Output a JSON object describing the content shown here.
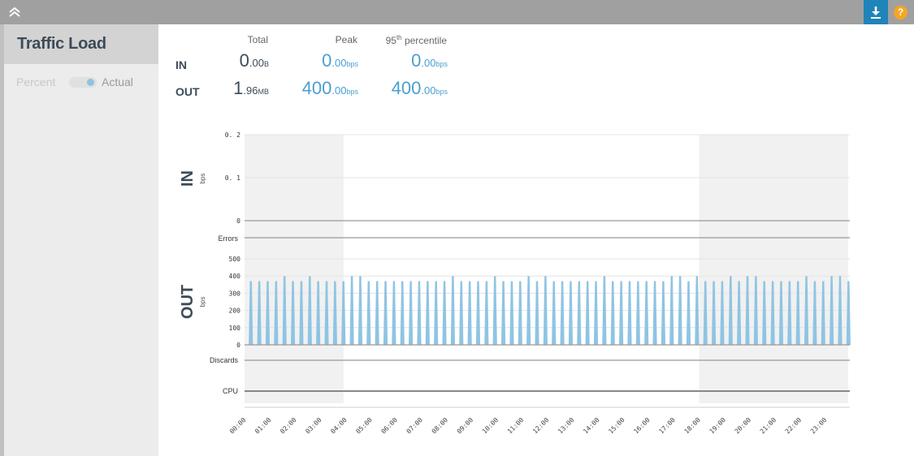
{
  "topbar": {
    "collapse_icon": "double-chevron-up-icon",
    "download_icon": "download-icon",
    "help_label": "?",
    "download_color": "#1f84b8",
    "help_color": "#f5a623"
  },
  "sidebar": {
    "title": "Traffic Load",
    "toggle": {
      "left_label": "Percent",
      "right_label": "Actual",
      "selected": "Actual"
    }
  },
  "stats": {
    "headers": {
      "total": "Total",
      "peak": "Peak",
      "p95_prefix": "95",
      "p95_sup": "th",
      "p95_suffix": " percentile"
    },
    "rows": [
      {
        "label": "IN",
        "total": {
          "int": "0",
          "dec": ".00",
          "unit": "B"
        },
        "peak": {
          "int": "0",
          "dec": ".00",
          "unit": "bps"
        },
        "p95": {
          "int": "0",
          "dec": ".00",
          "unit": "bps"
        }
      },
      {
        "label": "OUT",
        "total": {
          "int": "1",
          "dec": ".96",
          "unit": "MB"
        },
        "peak": {
          "int": "400",
          "dec": ".00",
          "unit": "bps"
        },
        "p95": {
          "int": "400",
          "dec": ".00",
          "unit": "bps"
        }
      }
    ]
  },
  "chart_data": {
    "type": "area",
    "title": "Traffic Load",
    "xlabel": "",
    "x_ticks": [
      "00:00",
      "01:00",
      "02:00",
      "03:00",
      "04:00",
      "05:00",
      "06:00",
      "07:00",
      "08:00",
      "09:00",
      "10:00",
      "11:00",
      "12:00",
      "13:00",
      "14:00",
      "15:00",
      "16:00",
      "17:00",
      "18:00",
      "19:00",
      "20:00",
      "21:00",
      "22:00",
      "23:00"
    ],
    "x_range_hours": [
      0,
      24
    ],
    "shaded_ranges_hours": [
      [
        0,
        3.92
      ],
      [
        18,
        24
      ]
    ],
    "series_color": "#8fc4e3",
    "panels": {
      "in": {
        "label": "IN",
        "unit": "bps",
        "ylim": [
          0,
          0.2
        ],
        "y_ticks": [
          "0",
          "0.1",
          "0.2"
        ],
        "values": []
      },
      "errors": {
        "label": "Errors"
      },
      "out": {
        "label": "OUT",
        "unit": "bps",
        "ylim": [
          0,
          500
        ],
        "y_ticks": [
          "0",
          "100",
          "200",
          "300",
          "400",
          "500"
        ],
        "spike_start_hour": 0.25,
        "spike_interval_hours": 0.3333,
        "values": [
          370,
          370,
          370,
          370,
          400,
          370,
          370,
          400,
          370,
          370,
          370,
          370,
          400,
          400,
          370,
          370,
          370,
          370,
          370,
          370,
          370,
          370,
          370,
          370,
          400,
          370,
          370,
          370,
          370,
          400,
          370,
          370,
          370,
          400,
          370,
          400,
          370,
          370,
          370,
          370,
          370,
          370,
          400,
          370,
          370,
          370,
          370,
          370,
          370,
          370,
          400,
          400,
          370,
          400,
          370,
          370,
          370,
          400,
          370,
          400,
          400,
          370,
          370,
          370,
          370,
          370,
          400,
          370,
          370,
          400,
          400,
          370
        ]
      },
      "discards": {
        "label": "Discards"
      },
      "cpu": {
        "label": "CPU"
      }
    }
  }
}
